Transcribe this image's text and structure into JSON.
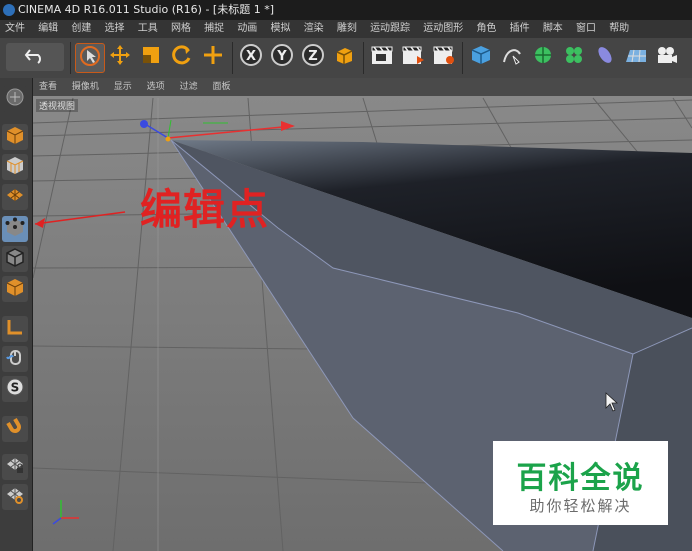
{
  "window": {
    "title": "CINEMA 4D R16.011 Studio (R16) - [未标题 1 *]"
  },
  "menubar": {
    "items": [
      "文件",
      "编辑",
      "创建",
      "选择",
      "工具",
      "网格",
      "捕捉",
      "动画",
      "模拟",
      "渲染",
      "雕刻",
      "运动跟踪",
      "运动图形",
      "角色",
      "插件",
      "脚本",
      "窗口",
      "帮助"
    ]
  },
  "viewport": {
    "menu": [
      "查看",
      "摄像机",
      "显示",
      "选项",
      "过滤",
      "面板"
    ],
    "label": "透视视图"
  },
  "annotation": {
    "text": "编辑点",
    "color": "#e02222"
  },
  "watermark": {
    "title": "百科全说",
    "subtitle": "助你轻松解决",
    "title_color": "#1ba34a"
  },
  "icons": {
    "toolbar": [
      "undo-icon",
      "select-icon",
      "move-icon",
      "scale-icon",
      "rotate-icon",
      "add-icon",
      "x-axis-icon",
      "y-axis-icon",
      "z-axis-icon",
      "coordinate-system-icon",
      "render-view-icon",
      "render-picture-viewer-icon",
      "edit-render-settings-icon",
      "cube-icon",
      "pen-icon",
      "subdivision-icon",
      "mograph-cloner-icon",
      "deformer-icon",
      "floor-icon",
      "camera-icon"
    ],
    "sidebar": [
      "make-editable-icon",
      "model-mode-icon",
      "texture-mode-icon",
      "points-mode-icon",
      "edges-mode-icon",
      "polygons-mode-icon",
      "axis-mode-icon",
      "tweak-mode-icon",
      "snap-icon",
      "magnet-icon",
      "workplane-icon",
      "lock-workplane-icon"
    ]
  }
}
